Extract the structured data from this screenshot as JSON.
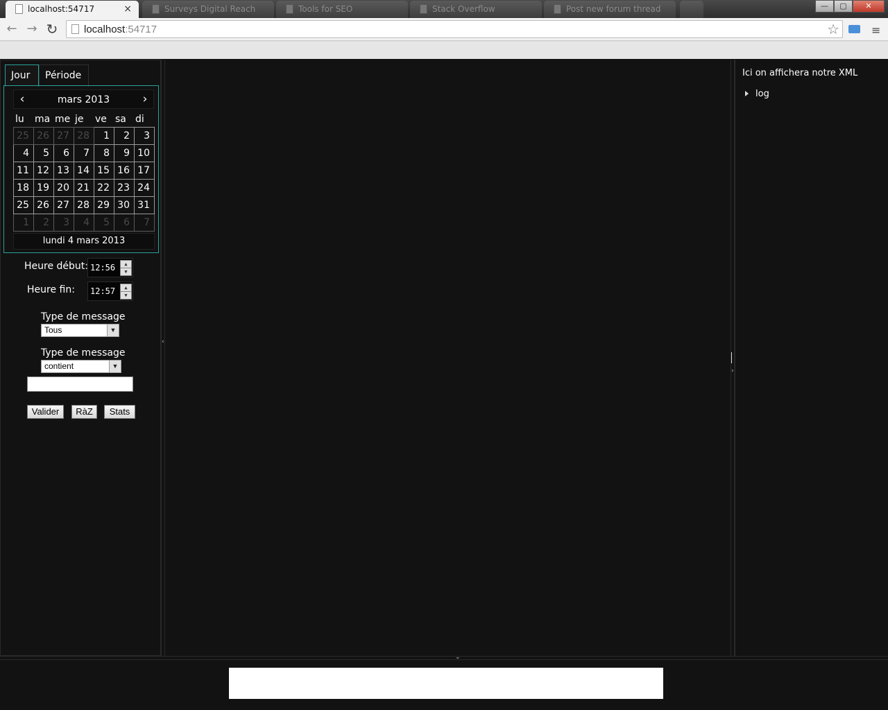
{
  "browser": {
    "tabs": [
      {
        "title": "localhost:54717",
        "active": true
      },
      {
        "title": "Surveys Digital Reach",
        "active": false
      },
      {
        "title": "Tools for SEO",
        "active": false
      },
      {
        "title": "Stack Overflow",
        "active": false
      },
      {
        "title": "Post new forum thread",
        "active": false
      }
    ],
    "tab_close": "×",
    "win_minimize": "—",
    "win_maximize": "▢",
    "win_close": "✕",
    "url_host": "localhost",
    "url_port": ":54717",
    "nav_back": "←",
    "nav_forward": "→",
    "nav_reload": "↻",
    "star": "☆",
    "menu": "≡"
  },
  "left": {
    "tab_jour": "Jour",
    "tab_periode": "Période",
    "calendar": {
      "prev": "‹",
      "next": "›",
      "title": "mars 2013",
      "dow": [
        "lu",
        "ma",
        "me",
        "je",
        "ve",
        "sa",
        "di"
      ],
      "weeks": [
        [
          {
            "d": "25",
            "o": true
          },
          {
            "d": "26",
            "o": true
          },
          {
            "d": "27",
            "o": true
          },
          {
            "d": "28",
            "o": true
          },
          {
            "d": "1",
            "o": false
          },
          {
            "d": "2",
            "o": false
          },
          {
            "d": "3",
            "o": false
          }
        ],
        [
          {
            "d": "4",
            "o": false
          },
          {
            "d": "5",
            "o": false
          },
          {
            "d": "6",
            "o": false
          },
          {
            "d": "7",
            "o": false
          },
          {
            "d": "8",
            "o": false
          },
          {
            "d": "9",
            "o": false
          },
          {
            "d": "10",
            "o": false
          }
        ],
        [
          {
            "d": "11",
            "o": false
          },
          {
            "d": "12",
            "o": false
          },
          {
            "d": "13",
            "o": false
          },
          {
            "d": "14",
            "o": false
          },
          {
            "d": "15",
            "o": false
          },
          {
            "d": "16",
            "o": false
          },
          {
            "d": "17",
            "o": false
          }
        ],
        [
          {
            "d": "18",
            "o": false
          },
          {
            "d": "19",
            "o": false
          },
          {
            "d": "20",
            "o": false
          },
          {
            "d": "21",
            "o": false
          },
          {
            "d": "22",
            "o": false
          },
          {
            "d": "23",
            "o": false
          },
          {
            "d": "24",
            "o": false
          }
        ],
        [
          {
            "d": "25",
            "o": false
          },
          {
            "d": "26",
            "o": false
          },
          {
            "d": "27",
            "o": false
          },
          {
            "d": "28",
            "o": false
          },
          {
            "d": "29",
            "o": false
          },
          {
            "d": "30",
            "o": false
          },
          {
            "d": "31",
            "o": false
          }
        ],
        [
          {
            "d": "1",
            "o": true
          },
          {
            "d": "2",
            "o": true
          },
          {
            "d": "3",
            "o": true
          },
          {
            "d": "4",
            "o": true
          },
          {
            "d": "5",
            "o": true
          },
          {
            "d": "6",
            "o": true
          },
          {
            "d": "7",
            "o": true
          }
        ]
      ],
      "footer": "lundi 4 mars 2013"
    },
    "heure_debut_label": "Heure début:",
    "heure_debut_value": "12:56",
    "heure_fin_label": "Heure fin:",
    "heure_fin_value": "12:57",
    "type1_label": "Type de message",
    "type1_value": "Tous",
    "type2_label": "Type de message",
    "type2_value": "contient",
    "search_value": "",
    "btn_valider": "Valider",
    "btn_raz": "RàZ",
    "btn_stats": "Stats"
  },
  "right": {
    "title": "Ici on affichera notre XML",
    "tree_node": "log"
  },
  "colors": {
    "background": "#121212",
    "accent": "#2aa198"
  }
}
